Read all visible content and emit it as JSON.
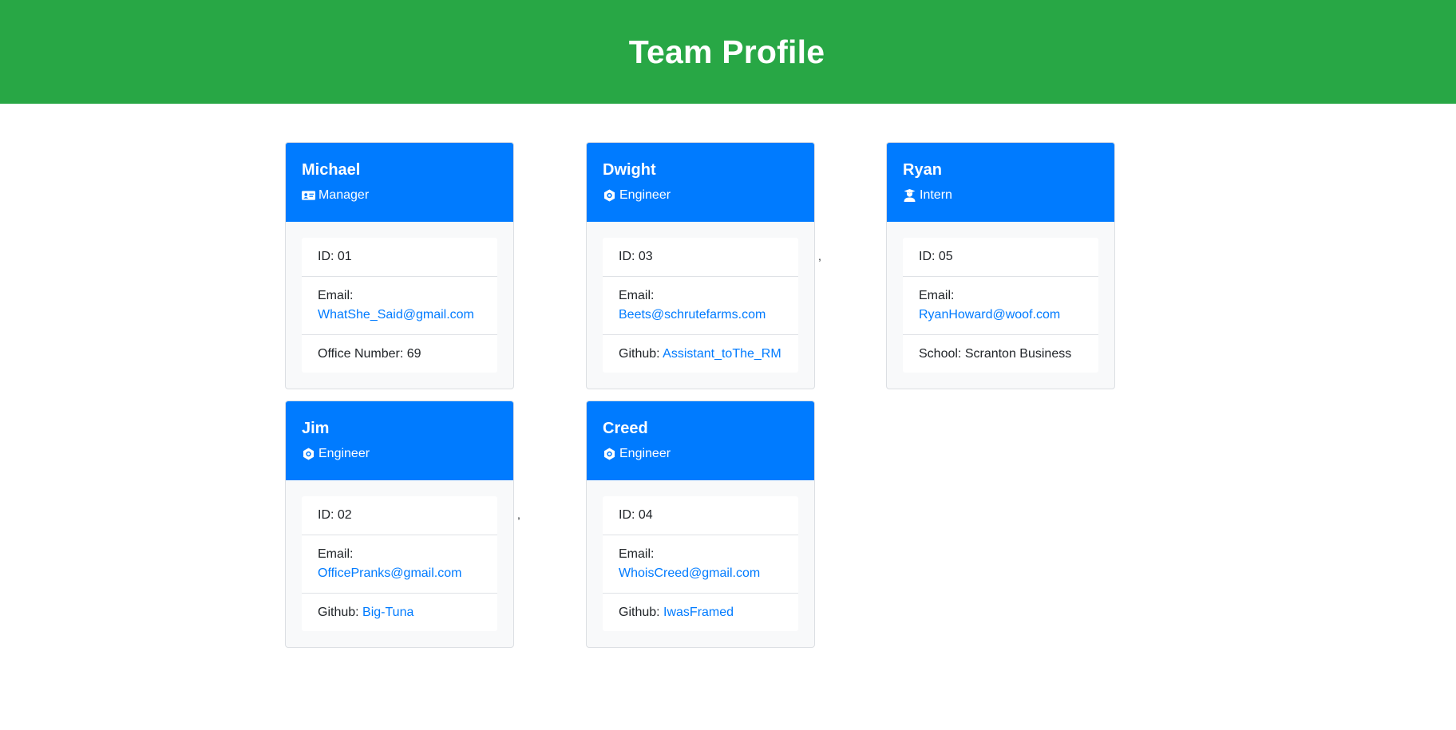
{
  "header": {
    "title": "Team Profile"
  },
  "cards": [
    {
      "name": "Michael",
      "role": "Manager",
      "role_icon": "id-card-icon",
      "id_label": "ID: 01",
      "email_label": "Email:",
      "email": "WhatShe_Said@gmail.com",
      "extra_label": "Office Number: 69",
      "extra_link": ""
    },
    {
      "name": "Dwight",
      "role": "Engineer",
      "role_icon": "cog-icon",
      "id_label": "ID: 03",
      "email_label": "Email:",
      "email": "Beets@schrutefarms.com",
      "extra_label": "Github: ",
      "extra_link": "Assistant_toThe_RM"
    },
    {
      "name": "Ryan",
      "role": "Intern",
      "role_icon": "user-graduate-icon",
      "id_label": "ID: 05",
      "email_label": "Email:",
      "email": "RyanHoward@woof.com",
      "extra_label": "School: Scranton Business",
      "extra_link": ""
    },
    {
      "name": "Jim",
      "role": "Engineer",
      "role_icon": "cog-icon",
      "id_label": "ID: 02",
      "email_label": "Email:",
      "email": "OfficePranks@gmail.com",
      "extra_label": "Github: ",
      "extra_link": "Big-Tuna"
    },
    {
      "name": "Creed",
      "role": "Engineer",
      "role_icon": "cog-icon",
      "id_label": "ID: 04",
      "email_label": "Email:",
      "email": "WhoisCreed@gmail.com",
      "extra_label": "Github: ",
      "extra_link": "IwasFramed"
    }
  ],
  "stray_commas": [
    ",",
    ","
  ],
  "colors": {
    "header_bg": "#28a745",
    "card_header_bg": "#007bff",
    "link": "#007bff",
    "card_bg": "#f8f9fa"
  }
}
